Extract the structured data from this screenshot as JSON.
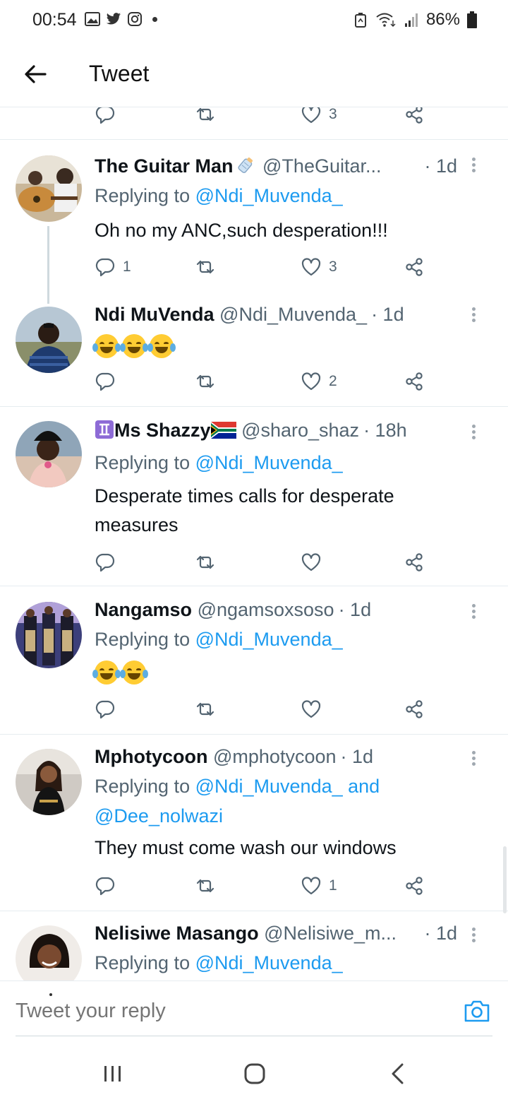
{
  "status_bar": {
    "time": "00:54",
    "battery": "86%",
    "icons_left": [
      "gallery-icon",
      "twitter-icon",
      "instagram-icon",
      "notification-dot"
    ],
    "icons_right": [
      "recycle-icon",
      "wifi-icon",
      "signal-icon",
      "battery-icon"
    ]
  },
  "header": {
    "title": "Tweet"
  },
  "partial_actions": {
    "like_count": "3"
  },
  "tweets": [
    {
      "name": "The Guitar Man",
      "name_emoji": "baby-bottle",
      "handle": "@TheGuitar...",
      "time": "· 1d",
      "replying_prefix": "Replying to ",
      "replying_to": "@Ndi_Muvenda_",
      "text": "Oh no my ANC,such desperation!!!",
      "replies": "1",
      "retweets": "",
      "likes": "3"
    },
    {
      "name": "Ndi MuVenda",
      "handle": "@Ndi_Muvenda_",
      "time": "· 1d",
      "emoji_count": 3,
      "replies": "",
      "retweets": "",
      "likes": "2"
    },
    {
      "name_prefix_emoji": "gemini-symbol",
      "name": "Ms Shazzy",
      "name_emoji": "south-africa-flag",
      "handle": "@sharo_shaz",
      "time": "· 18h",
      "replying_prefix": "Replying to ",
      "replying_to": "@Ndi_Muvenda_",
      "text": "Desperate times calls for desperate measures",
      "replies": "",
      "retweets": "",
      "likes": ""
    },
    {
      "name": "Nangamso",
      "handle": "@ngamsoxsoso",
      "time": "· 1d",
      "replying_prefix": "Replying to ",
      "replying_to": "@Ndi_Muvenda_",
      "emoji_count": 2,
      "replies": "",
      "retweets": "",
      "likes": ""
    },
    {
      "name": "Mphotycoon",
      "handle": "@mphotycoon",
      "time": "· 1d",
      "replying_prefix": "Replying to ",
      "replying_to": "@Ndi_Muvenda_",
      "replying_and": " and",
      "replying_to_2": "@Dee_nolwazi",
      "text": "They must come wash our windows",
      "replies": "",
      "retweets": "",
      "likes": "1"
    },
    {
      "name": "Nelisiwe Masango",
      "handle": "@Nelisiwe_m...",
      "time": "· 1d",
      "replying_prefix": "Replying to ",
      "replying_to": "@Ndi_Muvenda_"
    }
  ],
  "reply_bar": {
    "placeholder": "Tweet your reply"
  },
  "colors": {
    "link": "#1d9bf0",
    "secondary_text": "#536471",
    "divider": "#e6ecf0"
  }
}
